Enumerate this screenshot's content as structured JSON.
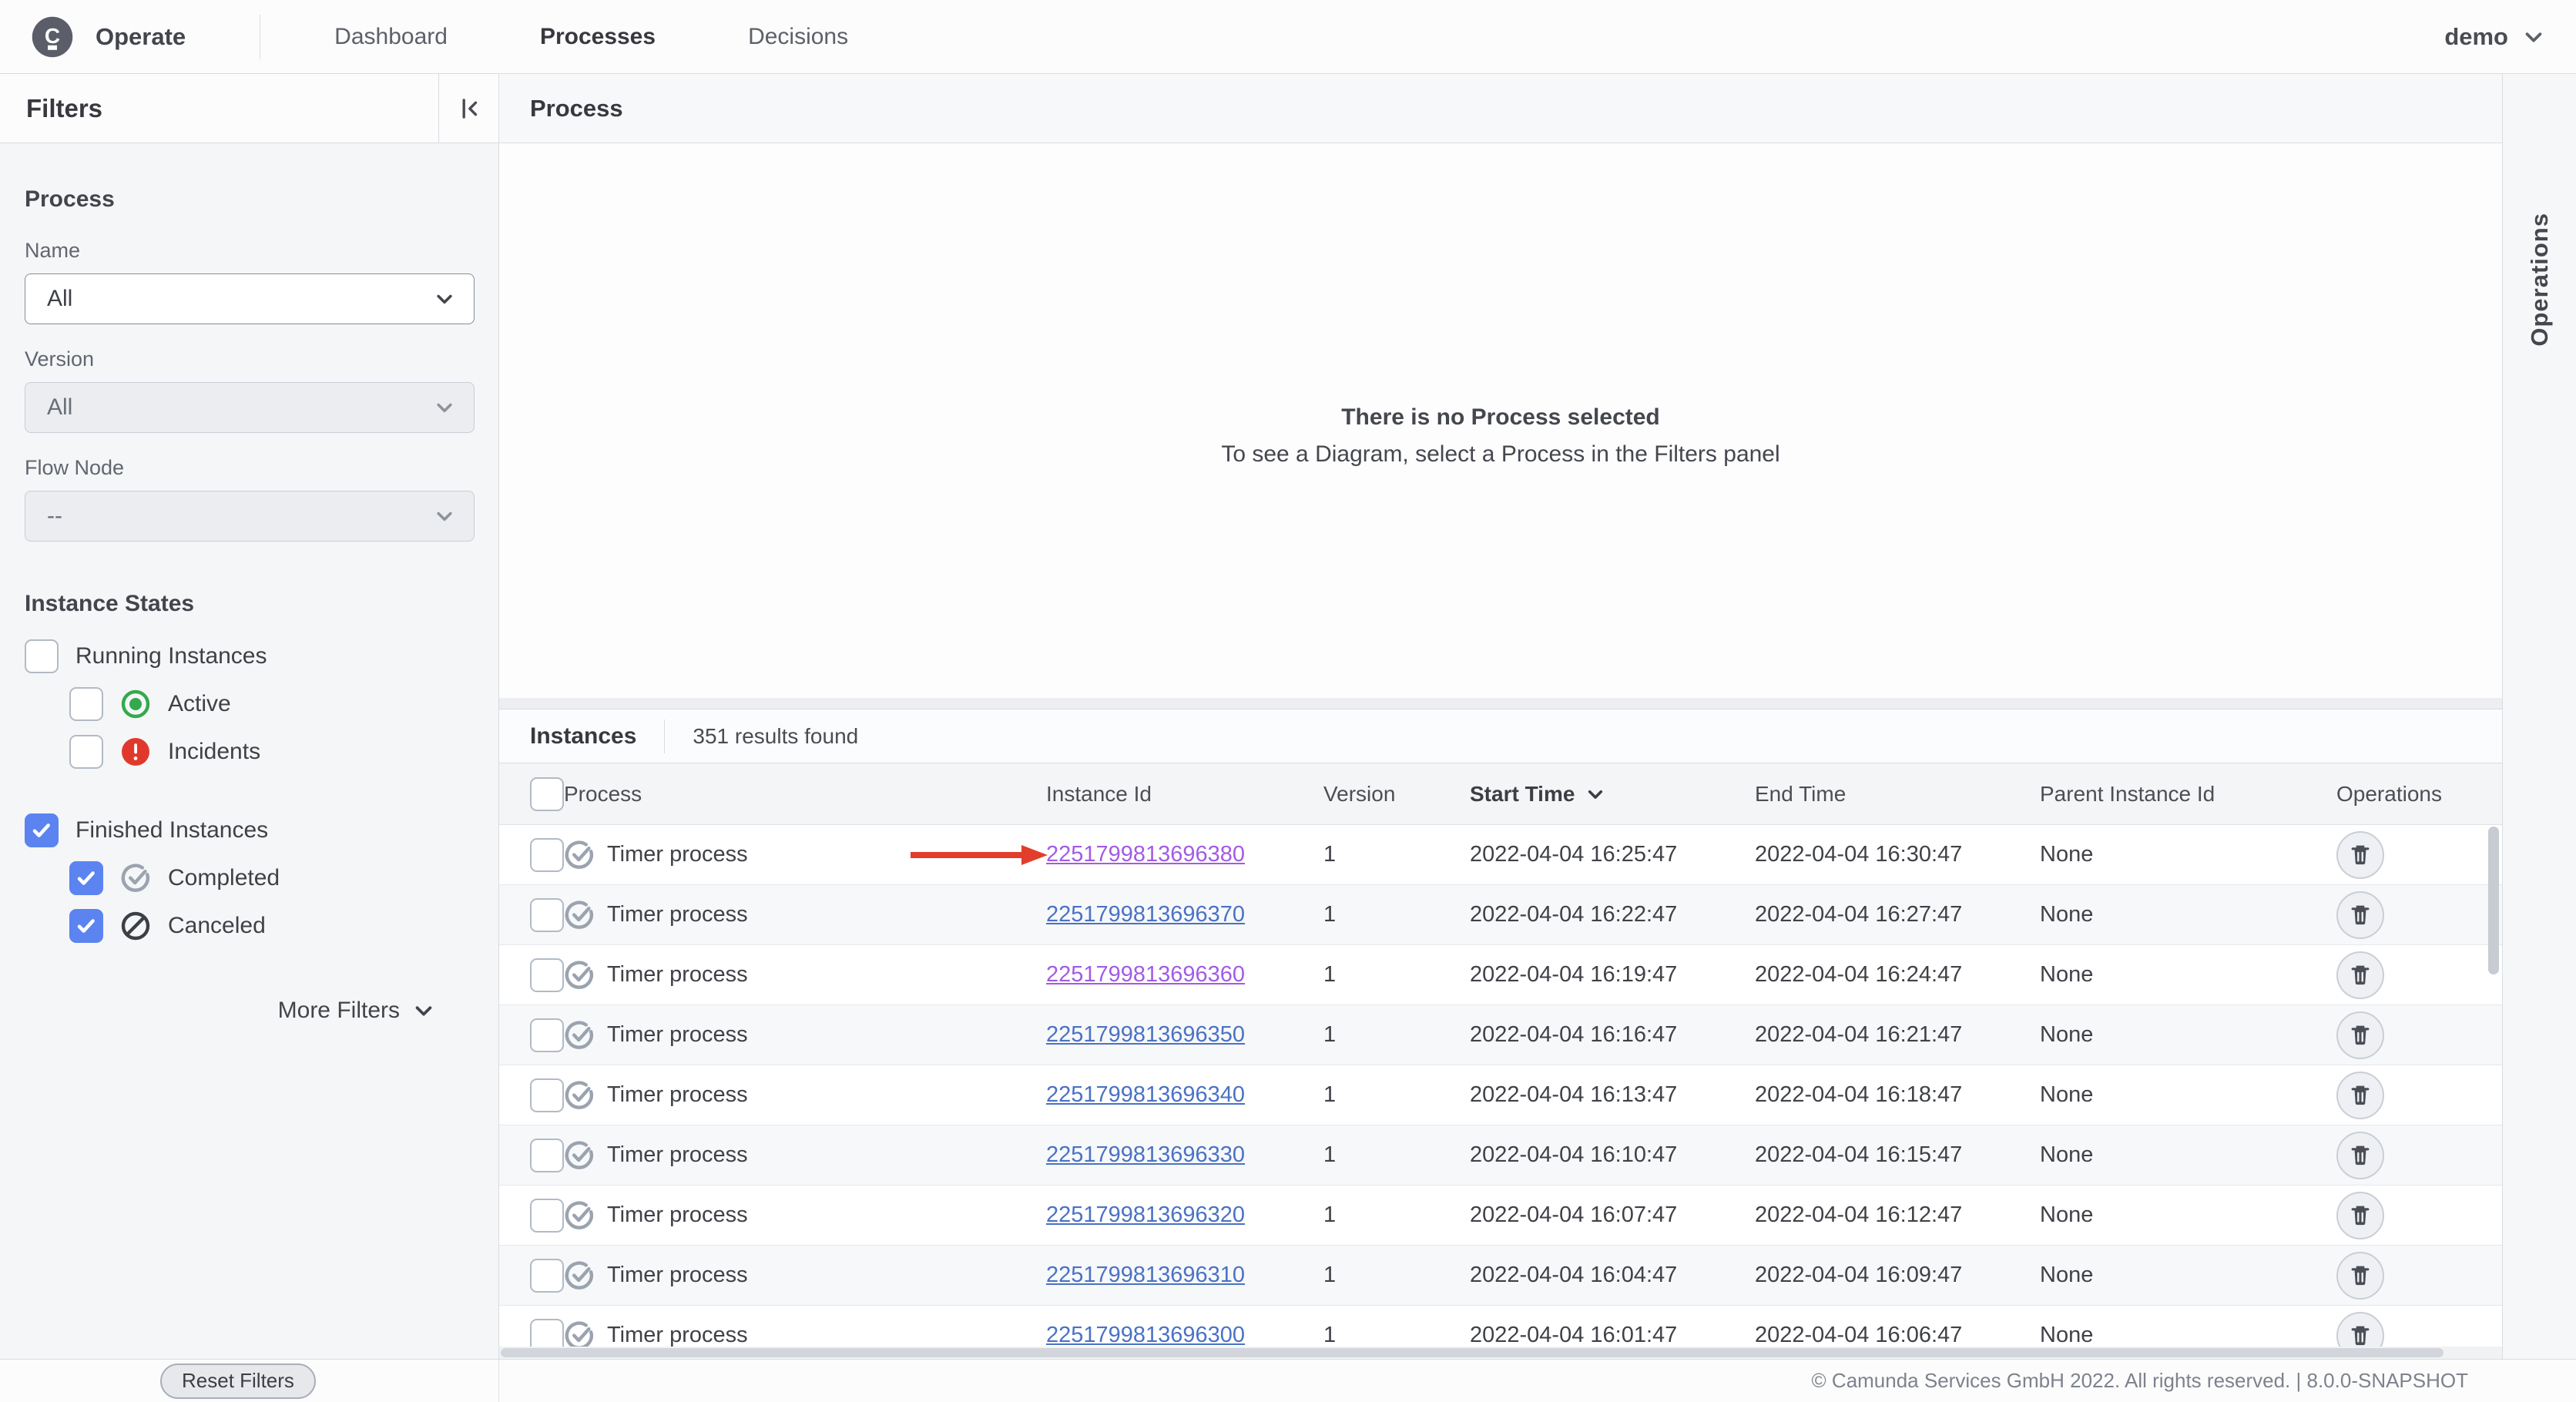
{
  "topbar": {
    "brand": "Operate",
    "nav": [
      {
        "label": "Dashboard",
        "active": false
      },
      {
        "label": "Processes",
        "active": true
      },
      {
        "label": "Decisions",
        "active": false
      }
    ],
    "user": "demo"
  },
  "filters": {
    "title": "Filters",
    "process_group_label": "Process",
    "fields": [
      {
        "label": "Name",
        "value": "All",
        "disabled": false
      },
      {
        "label": "Version",
        "value": "All",
        "disabled": true
      },
      {
        "label": "Flow Node",
        "value": "--",
        "disabled": true
      }
    ],
    "instance_states_label": "Instance States",
    "state_checkboxes": [
      {
        "label": "Running Instances",
        "checked": false,
        "indent": false,
        "spaced": false,
        "icon": null
      },
      {
        "label": "Active",
        "checked": false,
        "indent": true,
        "spaced": false,
        "icon": "active-icon"
      },
      {
        "label": "Incidents",
        "checked": false,
        "indent": true,
        "spaced": false,
        "icon": "incident-icon"
      },
      {
        "label": "Finished Instances",
        "checked": true,
        "indent": false,
        "spaced": true,
        "icon": null
      },
      {
        "label": "Completed",
        "checked": true,
        "indent": true,
        "spaced": false,
        "icon": "completed-icon"
      },
      {
        "label": "Canceled",
        "checked": true,
        "indent": true,
        "spaced": false,
        "icon": "canceled-icon"
      }
    ],
    "more_filters_label": "More Filters",
    "reset_button_label": "Reset Filters"
  },
  "process_panel": {
    "title": "Process",
    "empty_line1": "There is no Process selected",
    "empty_line2": "To see a Diagram, select a Process in the Filters panel"
  },
  "operations_panel": {
    "label": "Operations"
  },
  "instances": {
    "title": "Instances",
    "results_text": "351 results found",
    "columns": {
      "process": "Process",
      "instance_id": "Instance Id",
      "version": "Version",
      "start_time": "Start Time",
      "end_time": "End Time",
      "parent_instance_id": "Parent Instance Id",
      "operations": "Operations"
    },
    "sorted_column": "Start Time",
    "rows": [
      {
        "process": "Timer process",
        "state_icon": "completed-icon",
        "id": "2251799813696380",
        "version": "1",
        "start": "2022-04-04 16:25:47",
        "end": "2022-04-04 16:30:47",
        "parent": "None",
        "visited": true,
        "arrow": true
      },
      {
        "process": "Timer process",
        "state_icon": "completed-icon",
        "id": "2251799813696370",
        "version": "1",
        "start": "2022-04-04 16:22:47",
        "end": "2022-04-04 16:27:47",
        "parent": "None",
        "visited": false,
        "arrow": false
      },
      {
        "process": "Timer process",
        "state_icon": "completed-icon",
        "id": "2251799813696360",
        "version": "1",
        "start": "2022-04-04 16:19:47",
        "end": "2022-04-04 16:24:47",
        "parent": "None",
        "visited": true,
        "arrow": false
      },
      {
        "process": "Timer process",
        "state_icon": "completed-icon",
        "id": "2251799813696350",
        "version": "1",
        "start": "2022-04-04 16:16:47",
        "end": "2022-04-04 16:21:47",
        "parent": "None",
        "visited": false,
        "arrow": false
      },
      {
        "process": "Timer process",
        "state_icon": "completed-icon",
        "id": "2251799813696340",
        "version": "1",
        "start": "2022-04-04 16:13:47",
        "end": "2022-04-04 16:18:47",
        "parent": "None",
        "visited": false,
        "arrow": false
      },
      {
        "process": "Timer process",
        "state_icon": "completed-icon",
        "id": "2251799813696330",
        "version": "1",
        "start": "2022-04-04 16:10:47",
        "end": "2022-04-04 16:15:47",
        "parent": "None",
        "visited": false,
        "arrow": false
      },
      {
        "process": "Timer process",
        "state_icon": "completed-icon",
        "id": "2251799813696320",
        "version": "1",
        "start": "2022-04-04 16:07:47",
        "end": "2022-04-04 16:12:47",
        "parent": "None",
        "visited": false,
        "arrow": false
      },
      {
        "process": "Timer process",
        "state_icon": "completed-icon",
        "id": "2251799813696310",
        "version": "1",
        "start": "2022-04-04 16:04:47",
        "end": "2022-04-04 16:09:47",
        "parent": "None",
        "visited": false,
        "arrow": false
      },
      {
        "process": "Timer process",
        "state_icon": "completed-icon",
        "id": "2251799813696300",
        "version": "1",
        "start": "2022-04-04 16:01:47",
        "end": "2022-04-04 16:06:47",
        "parent": "None",
        "visited": false,
        "arrow": false
      }
    ]
  },
  "footer": {
    "copyright": "© Camunda Services GmbH 2022. All rights reserved. | 8.0.0-SNAPSHOT"
  },
  "colors": {
    "accent_checkbox": "#5b84f0",
    "link": "#4a72c4",
    "link_visited": "#a35be4",
    "status_active_green": "#34a94c",
    "status_incident_red": "#e0392b",
    "annotation_arrow_red": "#e23e2b"
  }
}
